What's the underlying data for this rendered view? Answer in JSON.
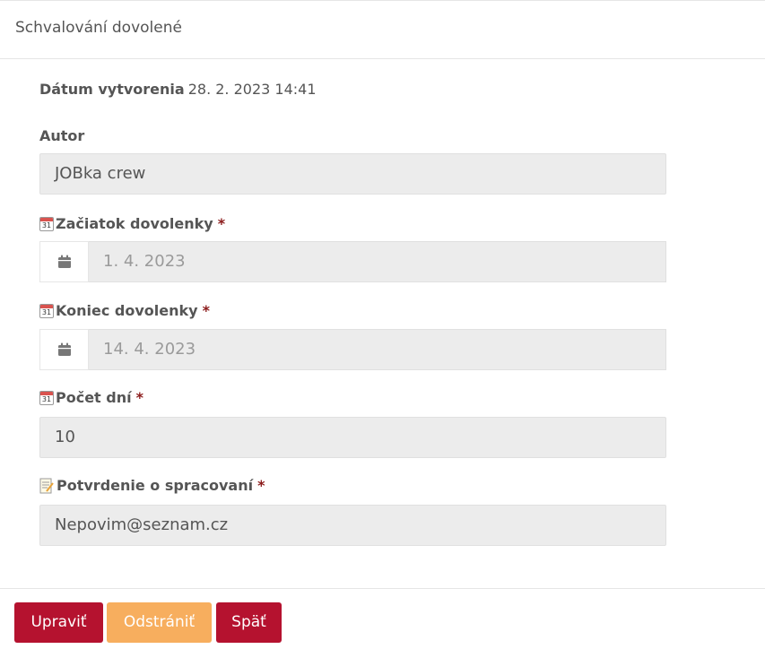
{
  "header": {
    "title": "Schvalování dovolené"
  },
  "meta": {
    "created_label": "Dátum vytvorenia",
    "created_value": "28. 2. 2023 14:41"
  },
  "fields": {
    "author": {
      "label": "Autor",
      "value": "JOBka crew"
    },
    "start": {
      "icon": "calendar-icon",
      "icon_day": "31",
      "label": "Začiatok dovolenky",
      "required_mark": "*",
      "value": "1. 4. 2023"
    },
    "end": {
      "icon": "calendar-icon",
      "icon_day": "31",
      "label": "Koniec dovolenky",
      "required_mark": "*",
      "value": "14. 4. 2023"
    },
    "days": {
      "icon": "calendar-icon",
      "icon_day": "31",
      "label": "Počet dní",
      "required_mark": "*",
      "value": "10"
    },
    "confirmation": {
      "icon": "memo-icon",
      "label": "Potvrdenie o spracovaní",
      "required_mark": "*",
      "value": "Nepovim@seznam.cz"
    }
  },
  "buttons": {
    "edit": "Upraviť",
    "delete": "Odstrániť",
    "back": "Späť"
  },
  "colors": {
    "primary": "#b5122f",
    "warning": "#f7ae5e",
    "required": "#8b1a1a",
    "input_bg": "#ececec"
  }
}
